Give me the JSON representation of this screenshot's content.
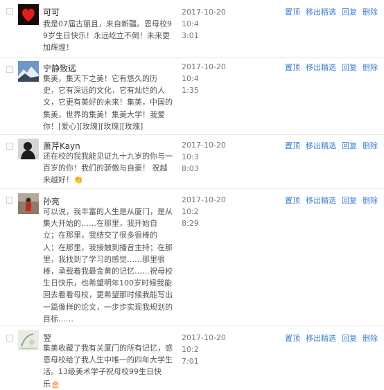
{
  "comments": [
    {
      "name": "可可",
      "content": "我是07届古丽且，来自新疆。恩母校9\n9岁生日快乐！永远屹立不倒！未来更\n加辉煌！",
      "time": "2017-10-20 10:4\n3:01",
      "avatar": "heart-avatar"
    },
    {
      "name": "宁静致远",
      "content": "集美，集天下之美！它有悠久的历\n史，它有深远的文化，它有灿烂的人\n文，它更有美好的未来！集美，中国的\n集美，世界的集美！集美大学！我爱\n你！[爱心][玫瑰][玫瑰][玫瑰]",
      "time": "2017-10-20 10:4\n1:35",
      "avatar": "mountain-avatar"
    },
    {
      "name": "萧芹Kayn",
      "content": "还在校的我我能见证九十九岁的你与一\n百岁的你！我们的骄傲与自豪！ 祝越\n来越好！👏",
      "time": "2017-10-20 10:3\n8:03",
      "avatar": "person-dark-avatar"
    },
    {
      "name": "孙亮",
      "content": "可以说，我丰富的人生是从厦门，是从\n集大开始的……在那里，我开始自\n立；在那里，我结交了很多很棒的\n人；在那里，我接触到播音主持；在那\n里，我找到了学习的感觉……那里很\n棒，承载着我最金黄的记忆……祝母校\n生日快乐，也希望明年100岁时候我能\n回去看看母校，更希望那时候我能写出\n一篇像样的论文，一步步实现我规划的\n目标……",
      "time": "2017-10-20 10:2\n8:29",
      "avatar": "red-figure-avatar"
    },
    {
      "name": "翌",
      "content": "集美收藏了我有关厦门的所有记忆，感\n恩母校给了我人生中唯一的四年大学生\n活。13级美术学子祝母校99生日快\n乐🎂",
      "time": "2017-10-20 10:2\n7:01",
      "avatar": "sketch-avatar"
    }
  ],
  "actions": [
    "置顶",
    "移出精选",
    "回复",
    "删除"
  ],
  "colors": {
    "link": "#3d7fd1",
    "divider": "#e6e6e6"
  }
}
